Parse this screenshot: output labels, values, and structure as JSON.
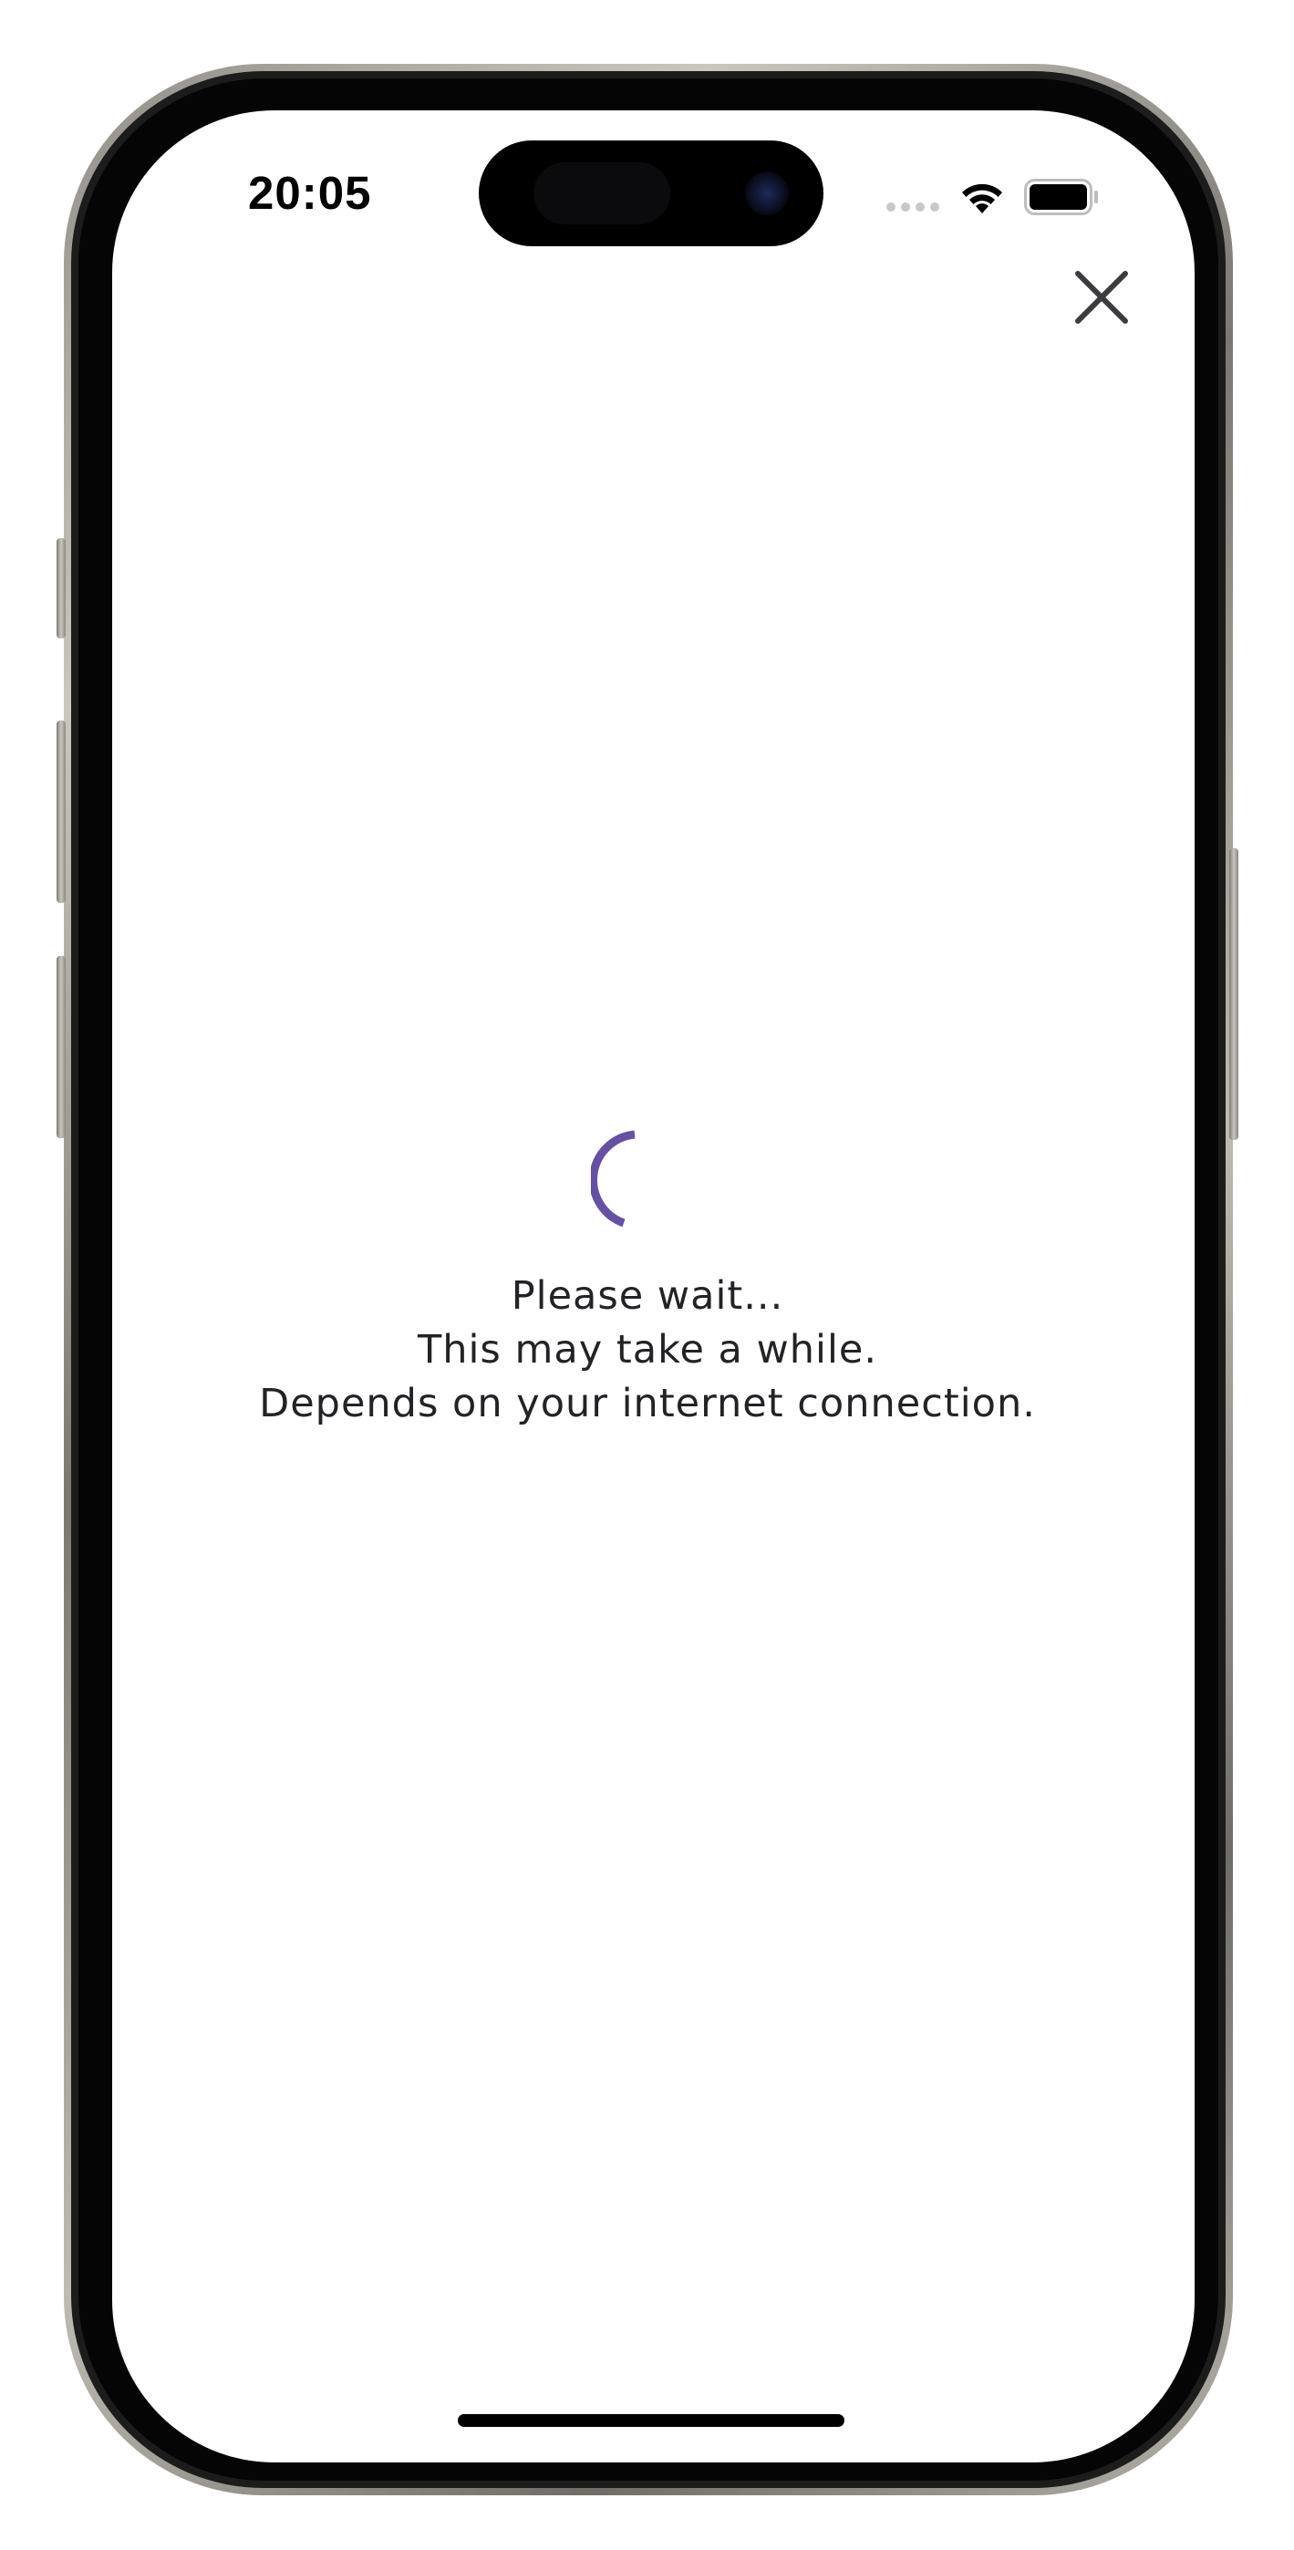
{
  "status_bar": {
    "time": "20:05"
  },
  "icons": {
    "close": "close-icon",
    "spinner": "loading-spinner-icon",
    "wifi": "wifi-icon",
    "battery": "battery-icon"
  },
  "loading": {
    "line1": "Please wait...",
    "line2": "This may take a while.",
    "line3": "Depends on your internet connection."
  },
  "colors": {
    "spinner_accent": "#6650a4",
    "text": "#222326",
    "close_icon": "#3c3c40"
  }
}
